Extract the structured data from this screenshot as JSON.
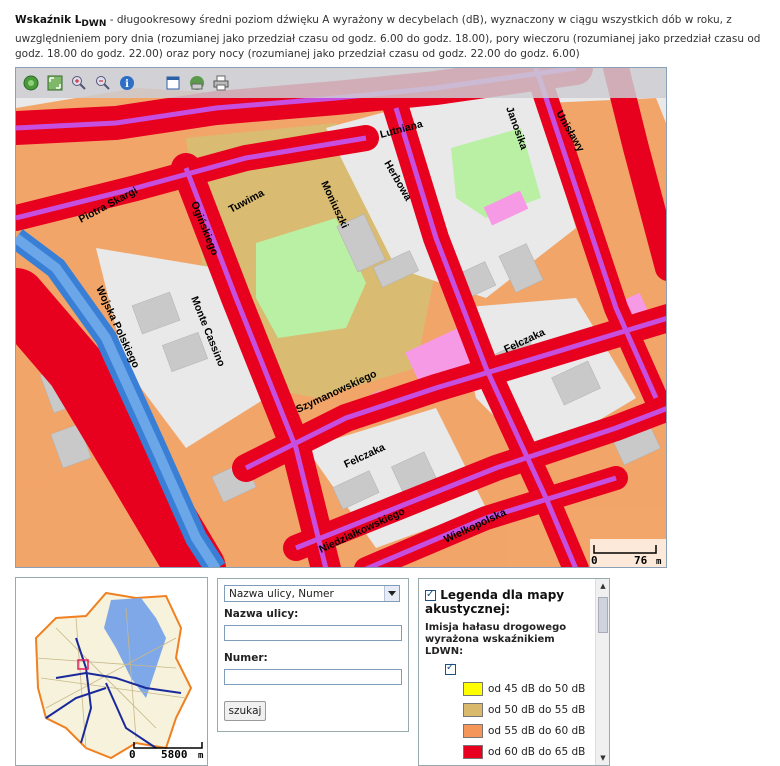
{
  "description": {
    "term": "Wskaźnik L",
    "term_sub": "DWN",
    "text": " - długookresowy średni poziom dźwięku A wyrażony w decybelach (dB), wyznaczony w ciągu wszystkich dób w roku, z uwzględnieniem pory dnia (rozumianej jako przedział czasu od godz. 6.00 do godz. 18.00), pory wieczoru (rozumianej jako przedział czasu od godz. 18.00 do godz. 22.00) oraz pory nocy (rozumianej jako przedział czasu od godz. 22.00 do godz. 6.00)"
  },
  "toolbar": {
    "icons": [
      "globe-icon",
      "zoom-full-icon",
      "zoom-in-icon",
      "zoom-out-icon",
      "info-icon",
      "window-icon",
      "layers-icon",
      "print-icon"
    ]
  },
  "map": {
    "streets": [
      "Lutniana",
      "Janosika",
      "Unisławy",
      "Herbowa",
      "Piotra Skargi",
      "Tuwima",
      "Moniuszki",
      "Ogińskiego",
      "Wojska Polskiego",
      "Monte Cassino",
      "Szymanowskiego",
      "Felczaka",
      "Felczaka",
      "Niedziałkowskiego",
      "Wielkopolska"
    ],
    "scale": {
      "zero": "0",
      "value": "76",
      "unit": "m"
    }
  },
  "overview": {
    "scale": {
      "zero": "0",
      "value": "5800",
      "unit": "m"
    }
  },
  "search": {
    "select_value": "Nazwa ulicy, Numer",
    "street_label": "Nazwa ulicy:",
    "street_value": "",
    "number_label": "Numer:",
    "number_value": "",
    "button_label": "szukaj"
  },
  "legend": {
    "title": "Legenda dla mapy akustycznej:",
    "subtitle": "Imisja hałasu drogowego wyrażona wskaźnikiem LDWN:",
    "items": [
      {
        "label": "od 45 dB do 50 dB",
        "color": "#ffff00"
      },
      {
        "label": "od 50 dB do 55 dB",
        "color": "#d9b96b"
      },
      {
        "label": "od 55 dB do 60 dB",
        "color": "#f4965a"
      },
      {
        "label": "od 60 dB do 65 dB",
        "color": "#e8001f"
      }
    ]
  }
}
